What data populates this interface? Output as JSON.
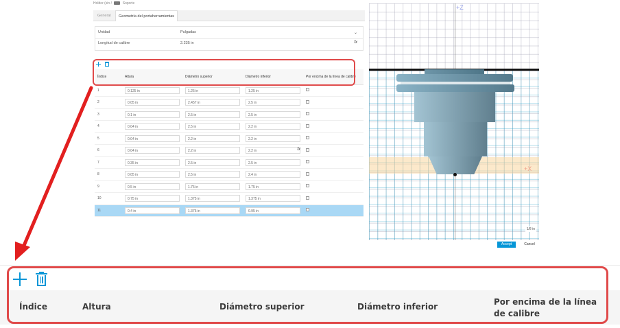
{
  "breadcrumb": {
    "parent": "Holder (sin",
    "separator": "/",
    "current": "Soporte"
  },
  "tabs": [
    {
      "label": "General",
      "active": false
    },
    {
      "label": "Geometría del portaherramientas",
      "active": true
    }
  ],
  "settings": {
    "unit_label": "Unidad",
    "unit_value": "Pulgadas",
    "gauge_label": "Longitud de calibre",
    "gauge_value": "2.235 in",
    "fx_symbol": "fx"
  },
  "table": {
    "columns": [
      "Índice",
      "Altura",
      "Diámetro superior",
      "Diámetro inferior",
      "Por encima de la línea de calibre"
    ],
    "rows": [
      {
        "index": "1",
        "height": "0.125 in",
        "upper": "1.25 in",
        "lower": "1.25 in",
        "above": false,
        "fx": false,
        "selected": false
      },
      {
        "index": "2",
        "height": "0.05 in",
        "upper": "2.457 in",
        "lower": "2.5 in",
        "above": false,
        "fx": false,
        "selected": false
      },
      {
        "index": "3",
        "height": "0.1 in",
        "upper": "2.5 in",
        "lower": "2.5 in",
        "above": false,
        "fx": false,
        "selected": false
      },
      {
        "index": "4",
        "height": "0.04 in",
        "upper": "2.5 in",
        "lower": "2.2 in",
        "above": false,
        "fx": false,
        "selected": false
      },
      {
        "index": "5",
        "height": "0.04 in",
        "upper": "2.2 in",
        "lower": "2.2 in",
        "above": false,
        "fx": false,
        "selected": false
      },
      {
        "index": "6",
        "height": "0.04 in",
        "upper": "2.2 in",
        "lower": "2.2 in",
        "above": false,
        "fx": true,
        "selected": false
      },
      {
        "index": "7",
        "height": "0.35 in",
        "upper": "2.5 in",
        "lower": "2.5 in",
        "above": false,
        "fx": false,
        "selected": false
      },
      {
        "index": "8",
        "height": "0.05 in",
        "upper": "2.5 in",
        "lower": "2.4 in",
        "above": false,
        "fx": false,
        "selected": false
      },
      {
        "index": "9",
        "height": "0.5 in",
        "upper": "1.75 in",
        "lower": "1.75 in",
        "above": false,
        "fx": false,
        "selected": false
      },
      {
        "index": "10",
        "height": "0.75 in",
        "upper": "1.375 in",
        "lower": "1.375 in",
        "above": false,
        "fx": false,
        "selected": false
      },
      {
        "index": "11",
        "height": "0.4 in",
        "upper": "1.375 in",
        "lower": "0.95 in",
        "above": false,
        "fx": false,
        "selected": true
      }
    ]
  },
  "preview": {
    "z_axis": "+Z",
    "x_axis": "+X",
    "scale_label": "1/8 in"
  },
  "dialog": {
    "accept_label": "Accept",
    "cancel_label": "Cancel"
  },
  "zoom": {
    "headers": [
      "Índice",
      "Altura",
      "Diámetro superior",
      "Diámetro inferior",
      "Por encima de la línea de calibre"
    ]
  },
  "colors": {
    "accent": "#0696d7",
    "highlight": "#e04a4a",
    "selected_row": "#a9d8f5"
  }
}
